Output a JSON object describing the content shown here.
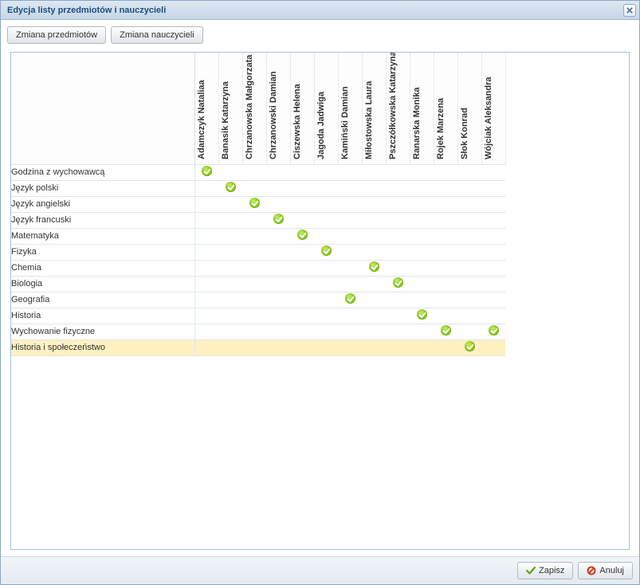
{
  "window": {
    "title": "Edycja listy przedmiotów i nauczycieli"
  },
  "toolbar": {
    "change_subjects": "Zmiana przedmiotów",
    "change_teachers": "Zmiana nauczycieli"
  },
  "teachers": [
    "Adamczyk Nataliaa",
    "Banasik Katarzyna",
    "Chrzanowska Małgorzata",
    "Chrzanowski Damian",
    "Ciszewska Helena",
    "Jagoda Jadwiga",
    "Kamiński Damian",
    "Miłostowska Laura",
    "Pszczółkowska Katarzyna",
    "Ranarska Monika",
    "Rojek Marzena",
    "Słok Konrad",
    "Wójciak Aleksandra"
  ],
  "subjects": [
    {
      "name": "Godzina z wychowawcą",
      "checks": [
        0
      ],
      "highlight": false
    },
    {
      "name": "Język polski",
      "checks": [
        1
      ],
      "highlight": false
    },
    {
      "name": "Język angielski",
      "checks": [
        2
      ],
      "highlight": false
    },
    {
      "name": "Język francuski",
      "checks": [
        3
      ],
      "highlight": false
    },
    {
      "name": "Matematyka",
      "checks": [
        4
      ],
      "highlight": false
    },
    {
      "name": "Fizyka",
      "checks": [
        5
      ],
      "highlight": false
    },
    {
      "name": "Chemia",
      "checks": [
        7
      ],
      "highlight": false
    },
    {
      "name": "Biologia",
      "checks": [
        8
      ],
      "highlight": false
    },
    {
      "name": "Geografia",
      "checks": [
        6
      ],
      "highlight": false
    },
    {
      "name": "Historia",
      "checks": [
        9
      ],
      "highlight": false
    },
    {
      "name": "Wychowanie fizyczne",
      "checks": [
        10,
        12
      ],
      "highlight": false
    },
    {
      "name": "Historia i społeczeństwo",
      "checks": [
        11
      ],
      "highlight": true
    }
  ],
  "footer": {
    "save": "Zapisz",
    "cancel": "Anuluj"
  }
}
